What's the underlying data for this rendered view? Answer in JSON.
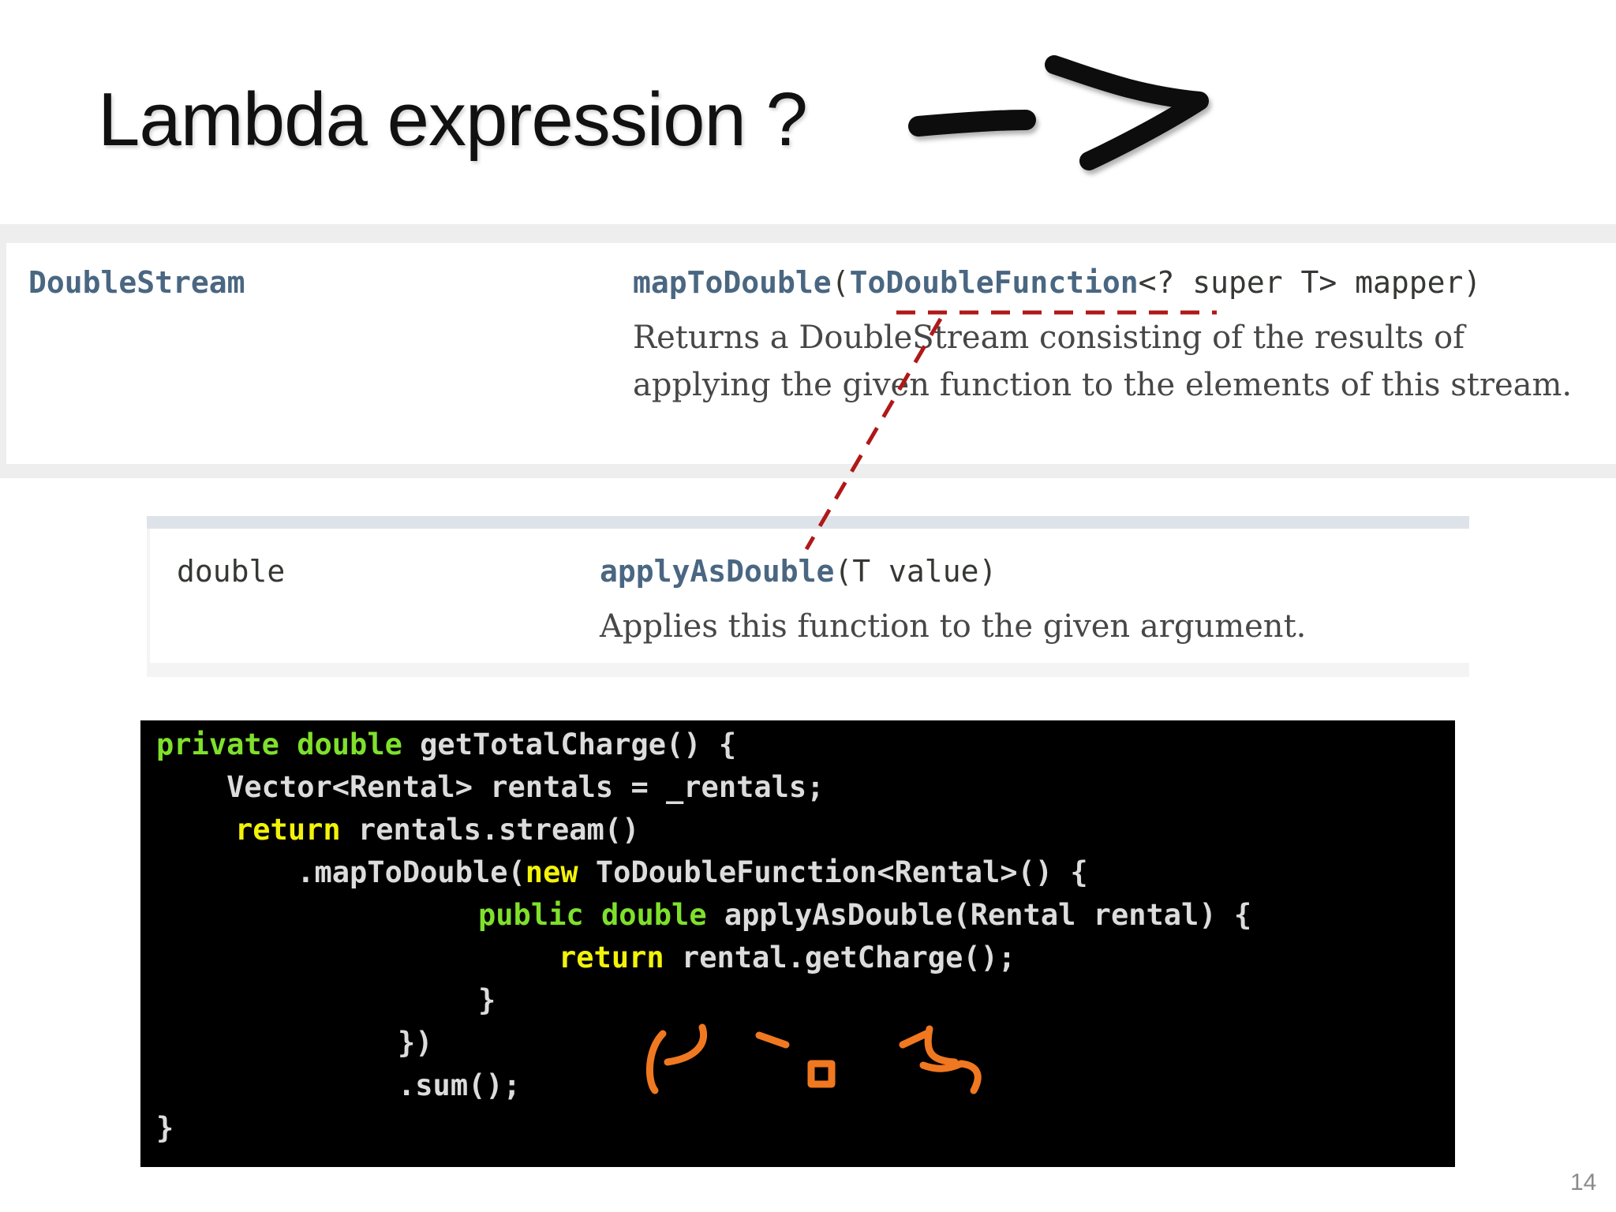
{
  "slide": {
    "title": "Lambda expression ?",
    "page_number": "14"
  },
  "doc_1": {
    "return_type": "DoubleStream",
    "method_name": "mapToDouble",
    "paren_open": "(",
    "param_type": "ToDoubleFunction",
    "param_rest": "<? super T> mapper)",
    "description": "Returns a DoubleStream consisting of the results of applying the given function to the elements of this stream."
  },
  "doc_2": {
    "return_type": "double",
    "method_name": "applyAsDouble",
    "params": "(T value)",
    "description": "Applies this function to the given argument."
  },
  "code": {
    "l1_kw1": "private",
    "l1_kw2": "double",
    "l1_rest": " getTotalCharge() {",
    "l2": "    Vector<Rental> rentals = _rentals;",
    "l3_kw": "return",
    "l3_rest": " rentals.stream()",
    "l4_pre": "        .mapToDouble(",
    "l4_kw": "new",
    "l4_rest": " ToDoubleFunction<Rental>() {",
    "l5_kw1": "public",
    "l5_kw2": "double",
    "l5_rest": " applyAsDouble(Rental rental) {",
    "l6_kw": "return",
    "l6_rest": " rental.getCharge();",
    "l7": "}",
    "l8": "})",
    "l9": ".sum();",
    "l10": "}"
  },
  "colors": {
    "keyword_green": "#7fe02c",
    "keyword_yellow": "#f2f20a",
    "connector_red": "#b01818",
    "face_orange": "#f07820",
    "javadoc_link": "#4a6782"
  },
  "icons": {
    "arrow": "hand-drawn-arrow-icon",
    "connector": "red-dashed-connector",
    "face": "emoticon-face-icon"
  }
}
